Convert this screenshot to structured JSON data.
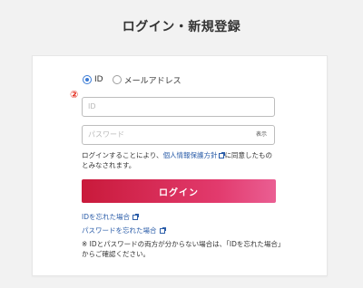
{
  "page": {
    "title": "ログイン・新規登録"
  },
  "login_type": {
    "options": [
      {
        "label": "ID",
        "checked": true
      },
      {
        "label": "メールアドレス",
        "checked": false
      }
    ]
  },
  "step_marker": "②",
  "id_field": {
    "placeholder": "ID"
  },
  "password_field": {
    "placeholder": "パスワード",
    "show_label": "表示"
  },
  "consent": {
    "prefix": "ログインすることにより、",
    "link_label": "個人情報保護方針",
    "suffix": "に同意したものとみなされます。"
  },
  "login_button": {
    "label": "ログイン"
  },
  "help_links": {
    "forgot_id": "IDを忘れた場合",
    "forgot_password": "パスワードを忘れた場合"
  },
  "note": "※ IDとパスワードの両方が分からない場合は、「IDを忘れた場合」からご確認ください。",
  "colors": {
    "accent": "#3a7bd5",
    "link": "#2a5ca8",
    "button_start": "#c91a3b",
    "button_end": "#ea5f93",
    "marker": "#e32b1c"
  }
}
